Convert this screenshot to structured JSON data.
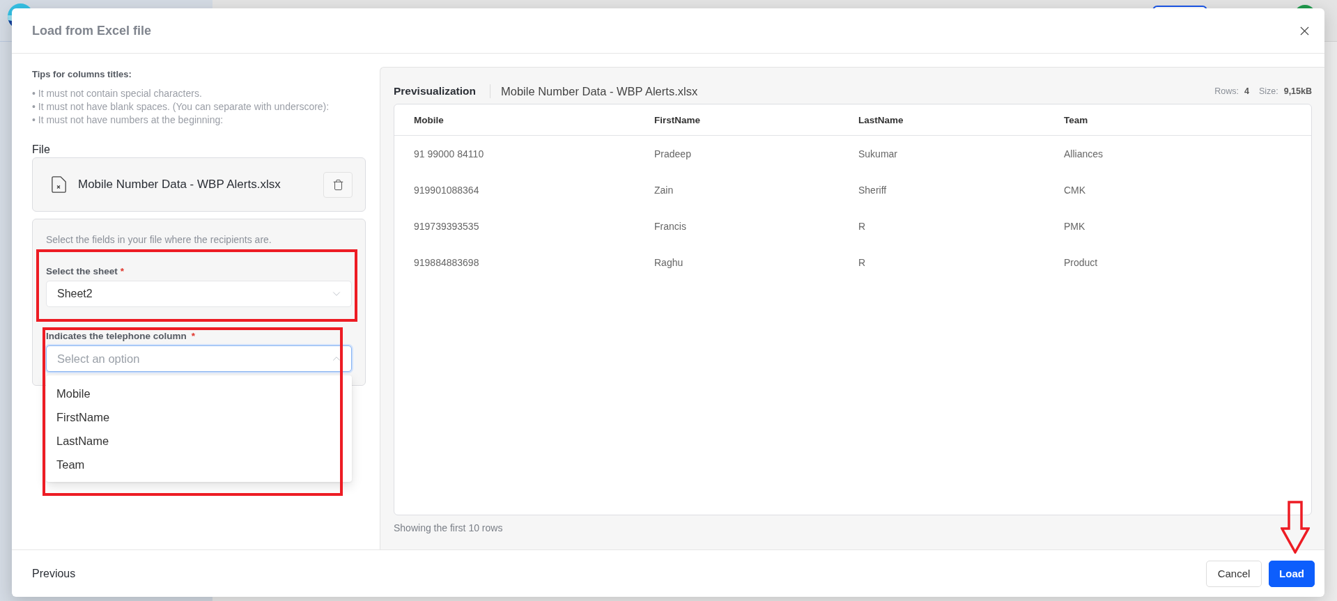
{
  "dialog": {
    "title": "Load from Excel file"
  },
  "tips": {
    "heading": "Tips for columns titles:",
    "items": [
      "• It must not contain special characters.",
      "• It must not have blank spaces. (You can separate with underscore):",
      "• It must not have numbers at the beginning:"
    ]
  },
  "file": {
    "label": "File",
    "name": "Mobile Number Data - WBP Alerts.xlsx"
  },
  "recipients": {
    "hint": "Select the fields in your file where the recipients are.",
    "sheet_field": {
      "label": "Select the sheet",
      "required_mark": "*",
      "value": "Sheet2",
      "expanded": false,
      "highlighted": true
    },
    "telephone_field": {
      "label": "Indicates the telephone column",
      "required_mark": "*",
      "placeholder": "Select an option",
      "expanded": true,
      "focused": true,
      "highlighted": true,
      "options": [
        {
          "label": "Mobile",
          "selected": false
        },
        {
          "label": "FirstName",
          "selected": false
        },
        {
          "label": "LastName",
          "selected": false
        },
        {
          "label": "Team",
          "selected": false
        }
      ]
    }
  },
  "preview": {
    "title": "Previsualization",
    "file_name": "Mobile Number Data - WBP Alerts.xlsx",
    "stats": [
      {
        "label": "Rows:",
        "value": "4"
      },
      {
        "label": "Size:",
        "value": "9,15kB"
      }
    ],
    "table": {
      "columns": [
        "Mobile",
        "FirstName",
        "LastName",
        "Team"
      ],
      "rows": [
        [
          "91 99000 84110",
          "Pradeep",
          "Sukumar",
          "Alliances"
        ],
        [
          "919901088364",
          "Zain",
          "Sheriff",
          "CMK"
        ],
        [
          "919739393535",
          "Francis",
          "R",
          "PMK"
        ],
        [
          "919884883698",
          "Raghu",
          "R",
          "Product"
        ]
      ]
    },
    "footnote": "Showing the first 10 rows"
  },
  "footer": {
    "previous": "Previous",
    "buttons": [
      {
        "label": "Cancel",
        "kind": "secondary"
      },
      {
        "label": "Load",
        "kind": "primary",
        "marked": true
      }
    ]
  }
}
